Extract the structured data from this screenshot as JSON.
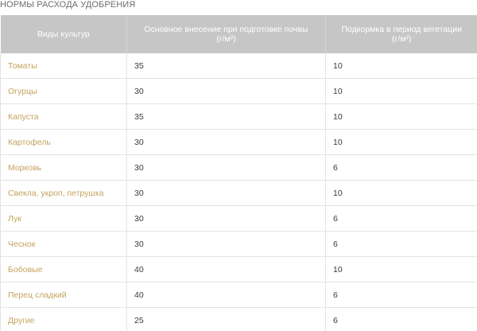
{
  "title": "НОРМЫ РАСХОДА УДОБРЕНИЯ",
  "table": {
    "headers": [
      {
        "line1": "Виды культур",
        "line2": ""
      },
      {
        "line1": "Основное внесение при подготовке почвы",
        "line2": "(г/м²)"
      },
      {
        "line1": "Подкормка в период вегетации",
        "line2": "(г/м²)"
      }
    ],
    "rows": [
      {
        "crop": "Томаты",
        "base": "35",
        "feed": "10"
      },
      {
        "crop": "Огурцы",
        "base": "30",
        "feed": "10"
      },
      {
        "crop": "Капуста",
        "base": "35",
        "feed": "10"
      },
      {
        "crop": "Картофель",
        "base": "30",
        "feed": "10"
      },
      {
        "crop": "Морковь",
        "base": "30",
        "feed": "6"
      },
      {
        "crop": "Свекла, укроп, петрушка",
        "base": "30",
        "feed": "10"
      },
      {
        "crop": "Лук",
        "base": "30",
        "feed": "6"
      },
      {
        "crop": "Чеснок",
        "base": "30",
        "feed": "6"
      },
      {
        "crop": "Бобовые",
        "base": "40",
        "feed": "10"
      },
      {
        "crop": "Перец сладкий",
        "base": "40",
        "feed": "6"
      },
      {
        "crop": "Другие",
        "base": "25",
        "feed": "6"
      }
    ]
  },
  "colors": {
    "header_bg": "#c6c6c6",
    "header_text": "#ffffff",
    "crop_text": "#c5a35f",
    "grid": "#e3e3e3"
  }
}
